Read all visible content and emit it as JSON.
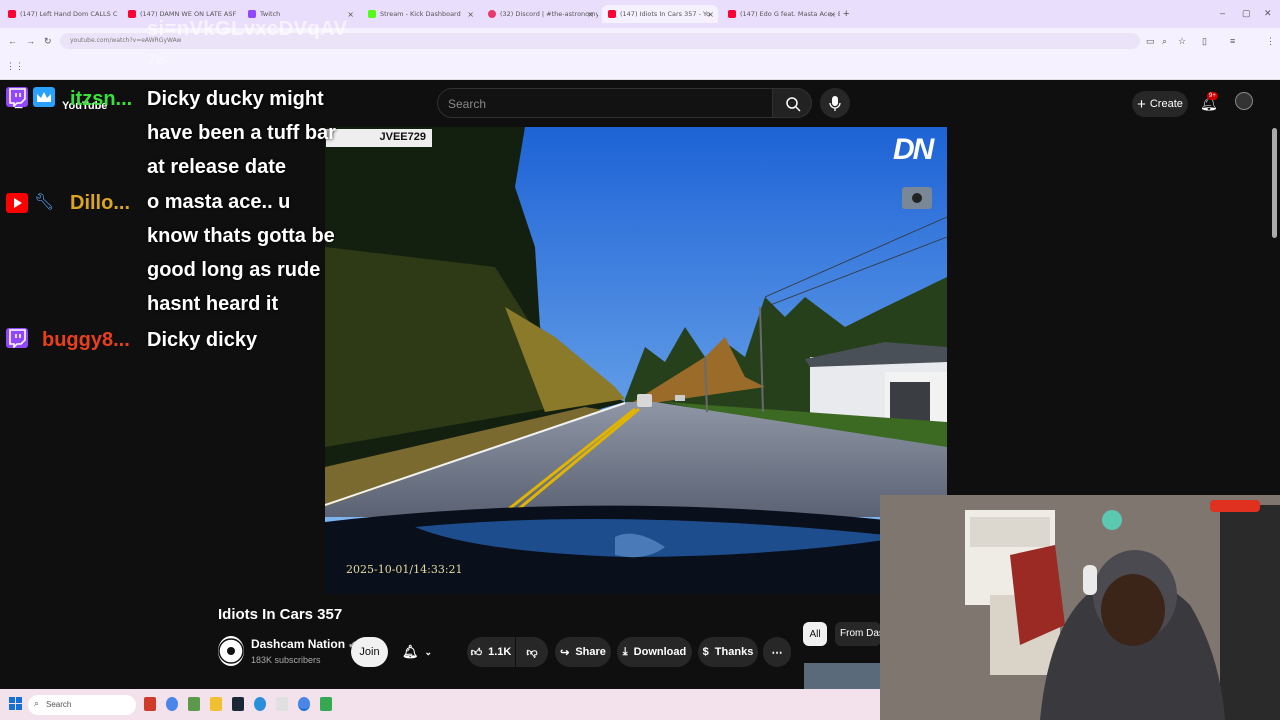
{
  "browser": {
    "tabs": [
      {
        "title": "(147) Left Hand Dom CALLS CI",
        "color": "#ff0033"
      },
      {
        "title": "(147) DAMN WE ON LATE ASF",
        "color": "#ff0033"
      },
      {
        "title": "Twitch",
        "color": "#9146ff"
      },
      {
        "title": "Stream - Kick Dashboard",
        "color": "#53fc18"
      },
      {
        "title": "(32) Discord | #the-astronomy",
        "color": "#e8386d"
      },
      {
        "title": "(147) Idiots In Cars 357 - Yo",
        "color": "#ff0033"
      },
      {
        "title": "(147) Edo G feat. Masta Ace - E",
        "color": "#ff0033"
      }
    ],
    "url": "youtube.com/watch?v=eAWRGyWAw",
    "url_overlay": "si=nVkGLvxcDVqAV",
    "url_overlay2": "7e-"
  },
  "youtube": {
    "logo_text": "YouTube",
    "search_placeholder": "Search",
    "create_label": "Create",
    "notif_badge": "9+",
    "video": {
      "plate": "JVEE729",
      "watermark": "DN",
      "timestamp": "2025-10-01/14:33:21",
      "title": "Idiots In Cars 357"
    },
    "channel": {
      "name": "Dashcam Nation",
      "subscribers": "183K subscribers",
      "logo_text": "DASHCAM NATION"
    },
    "actions": {
      "join": "Join",
      "likes": "1.1K",
      "share": "Share",
      "download": "Download",
      "thanks": "Thanks"
    },
    "chips": {
      "all": "All",
      "from": "From Dash"
    }
  },
  "chat": [
    {
      "platform": "twitch",
      "user": "itzsn...",
      "user_color": "#38e238",
      "lines": [
        "Dicky ducky might",
        "have been a tuff bar",
        "at release date"
      ]
    },
    {
      "platform": "youtube",
      "user": "Dillo...",
      "user_color": "#daa520",
      "lines": [
        "o masta ace.. u",
        "know thats gotta be",
        "good long as rude",
        "hasnt heard it"
      ]
    },
    {
      "platform": "twitch",
      "user": "buggy8...",
      "user_color": "#e8401c",
      "lines": [
        "Dicky dicky"
      ]
    }
  ],
  "taskbar": {
    "search_label": "Search"
  },
  "colors": {
    "twitch": "#9146ff",
    "youtube": "#ff0000",
    "browser_bg": "#e9defb"
  }
}
